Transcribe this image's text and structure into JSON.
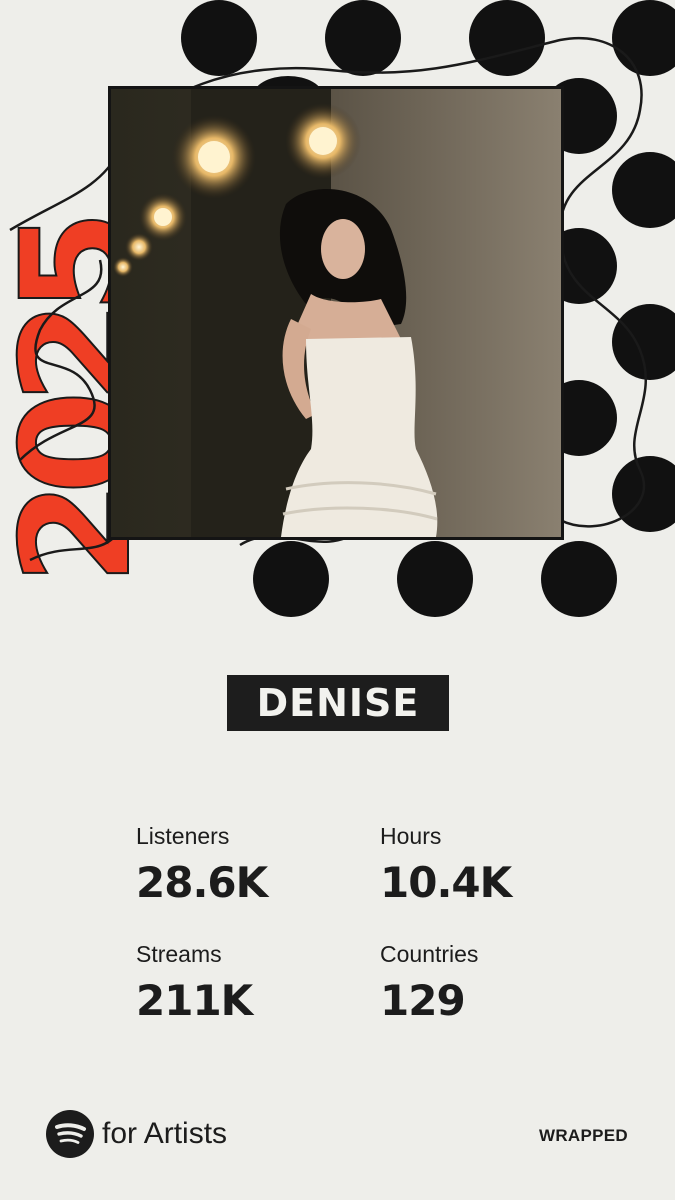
{
  "year": "2025",
  "artist": {
    "name": "DENISE"
  },
  "stats": [
    {
      "label": "Listeners",
      "value": "28.6K"
    },
    {
      "label": "Hours",
      "value": "10.4K"
    },
    {
      "label": "Streams",
      "value": "211K"
    },
    {
      "label": "Countries",
      "value": "129"
    }
  ],
  "footer": {
    "brand_icon": "spotify-icon",
    "brand_text": "for Artists",
    "tag": "WRAPPED"
  },
  "colors": {
    "background": "#eeeeea",
    "accent": "#ef3e24",
    "ink": "#111111"
  }
}
